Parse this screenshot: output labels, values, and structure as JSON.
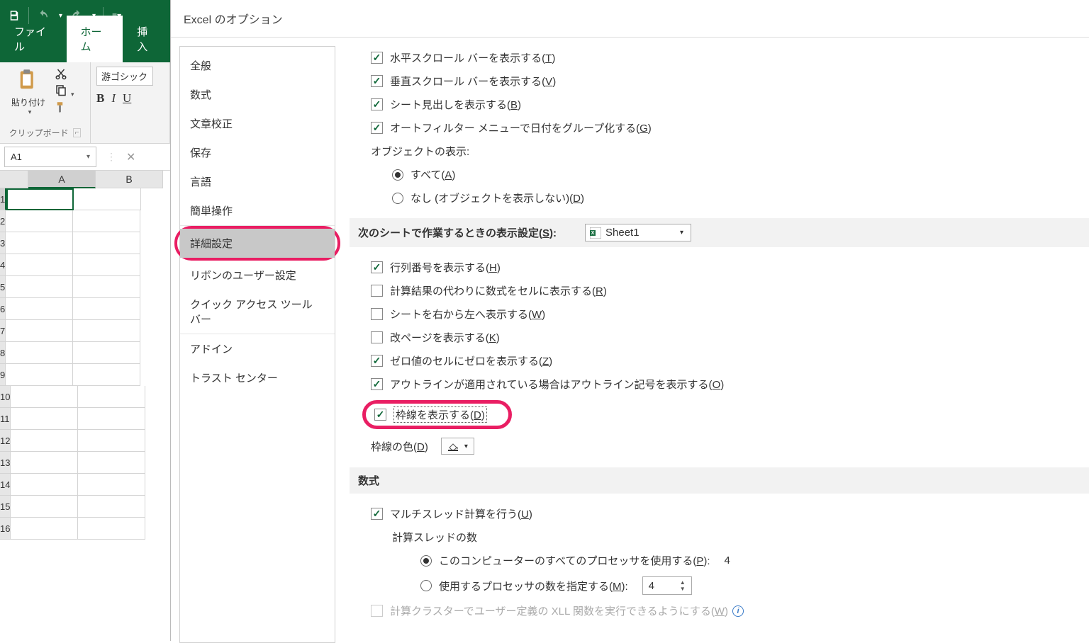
{
  "ribbon": {
    "tabs": {
      "file": "ファイル",
      "home": "ホーム",
      "insert": "挿入"
    },
    "clipboard_label": "クリップボード",
    "paste_label": "貼り付け",
    "font_name": "游ゴシック",
    "fmt": {
      "b": "B",
      "i": "I",
      "u": "U"
    }
  },
  "name_box": "A1",
  "col_headers": [
    "A",
    "B"
  ],
  "row_headers": [
    "1",
    "2",
    "3",
    "4",
    "5",
    "6",
    "7",
    "8",
    "9",
    "10",
    "11",
    "12",
    "13",
    "14",
    "15",
    "16"
  ],
  "dlg": {
    "title": "Excel のオプション",
    "nav": {
      "general": "全般",
      "formulas": "数式",
      "proofing": "文章校正",
      "save": "保存",
      "language": "言語",
      "ease": "簡単操作",
      "advanced": "詳細設定",
      "custom_ribbon": "リボンのユーザー設定",
      "qat": "クイック アクセス ツール バー",
      "addins": "アドイン",
      "trust": "トラスト センター"
    },
    "opt": {
      "hscroll_pre": "水平スクロール バーを表示する(",
      "hscroll_key": "T",
      "hscroll_post": ")",
      "vscroll_pre": "垂直スクロール バーを表示する(",
      "vscroll_key": "V",
      "vscroll_post": ")",
      "sheettabs_pre": "シート見出しを表示する(",
      "sheettabs_key": "B",
      "sheettabs_post": ")",
      "autofilter_pre": "オートフィルター メニューで日付をグループ化する(",
      "autofilter_key": "G",
      "autofilter_post": ")",
      "objects_label": "オブジェクトの表示:",
      "obj_all_pre": "すべて(",
      "obj_all_key": "A",
      "obj_all_post": ")",
      "obj_none_pre": "なし (オブジェクトを表示しない)(",
      "obj_none_key": "D",
      "obj_none_post": ")",
      "section_sheet_pre": "次のシートで作業するときの表示設定(",
      "section_sheet_key": "S",
      "section_sheet_post": "):",
      "sheet_name": "Sheet1",
      "rowcol_pre": "行列番号を表示する(",
      "rowcol_key": "H",
      "rowcol_post": ")",
      "showfml_pre": "計算結果の代わりに数式をセルに表示する(",
      "showfml_key": "R",
      "showfml_post": ")",
      "rtl_pre": "シートを右から左へ表示する(",
      "rtl_key": "W",
      "rtl_post": ")",
      "pagebr_pre": "改ページを表示する(",
      "pagebr_key": "K",
      "pagebr_post": ")",
      "zero_pre": "ゼロ値のセルにゼロを表示する(",
      "zero_key": "Z",
      "zero_post": ")",
      "outline_pre": "アウトラインが適用されている場合はアウトライン記号を表示する(",
      "outline_key": "O",
      "outline_post": ")",
      "gridlines_pre": "枠線を表示する(",
      "gridlines_key": "D",
      "gridlines_post": ")",
      "gridcolor_pre": "枠線の色(",
      "gridcolor_key": "D",
      "gridcolor_post": ")",
      "section_formulas": "数式",
      "multithread_pre": "マルチスレッド計算を行う(",
      "multithread_key": "U",
      "multithread_post": ")",
      "threads_label": "計算スレッドの数",
      "allproc_pre": "このコンピューターのすべてのプロセッサを使用する(",
      "allproc_key": "P",
      "allproc_post": ":",
      "proc_count": "4",
      "manual_pre": "使用するプロセッサの数を指定する(",
      "manual_key": "M",
      "manual_post": ":",
      "manual_value": "4",
      "cluster_pre": "計算クラスターでユーザー定義の XLL 関数を実行できるようにする(",
      "cluster_key": "W",
      "cluster_post": ")"
    }
  }
}
